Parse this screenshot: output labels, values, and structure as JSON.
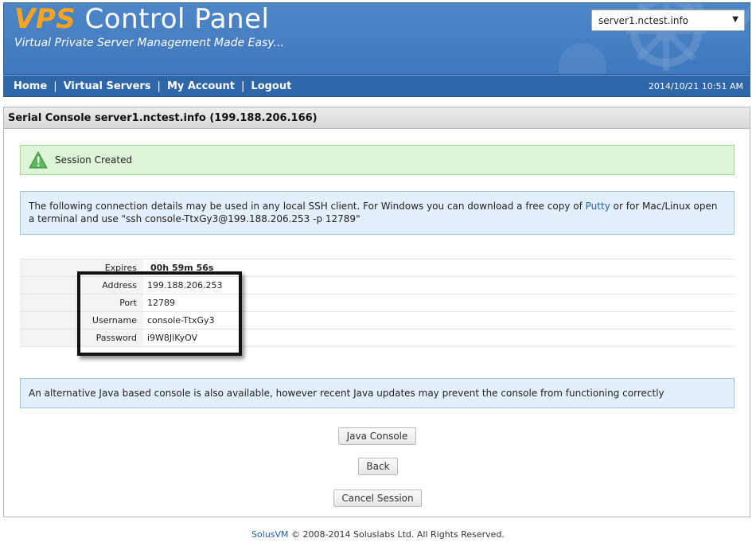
{
  "header": {
    "logo_vps": "VPS",
    "logo_rest": " Control Panel",
    "tagline": "Virtual Private Server Management Made Easy...",
    "server_select": "server1.nctest.info"
  },
  "nav": {
    "items": [
      "Home",
      "Virtual Servers",
      "My Account",
      "Logout"
    ],
    "separator": "|",
    "datetime": "2014/10/21 10:51 AM"
  },
  "panel": {
    "title": "Serial Console server1.nctest.info (199.188.206.166)",
    "success_msg": "Session Created",
    "info_part1": "The following connection details may be used in any local SSH client. For Windows you can download a free copy of ",
    "info_link": "Putty",
    "info_part2": " or for Mac/Linux open a terminal and use \"ssh console-TtxGy3@199.188.206.253 -p 12789\"",
    "details": [
      {
        "label": "Expires",
        "value": "00h 59m 56s"
      },
      {
        "label": "Address",
        "value": "199.188.206.253"
      },
      {
        "label": "Port",
        "value": "12789"
      },
      {
        "label": "Username",
        "value": "console-TtxGy3"
      },
      {
        "label": "Password",
        "value": "i9W8JlKyOV"
      }
    ],
    "java_info": "An alternative Java based console is also available, however recent Java updates may prevent the console from functioning correctly",
    "buttons": {
      "java": "Java Console",
      "back": "Back",
      "cancel": "Cancel Session"
    }
  },
  "footer": {
    "brand": "SolusVM",
    "text": " © 2008-2014 Soluslabs Ltd. All Rights Reserved."
  },
  "colors": {
    "header_bg": "#4a80c2",
    "nav_bg": "#2f66a8",
    "logo_accent": "#f7a51f",
    "success_bg": "#dff5d7",
    "info_bg": "#e3f0fb"
  }
}
